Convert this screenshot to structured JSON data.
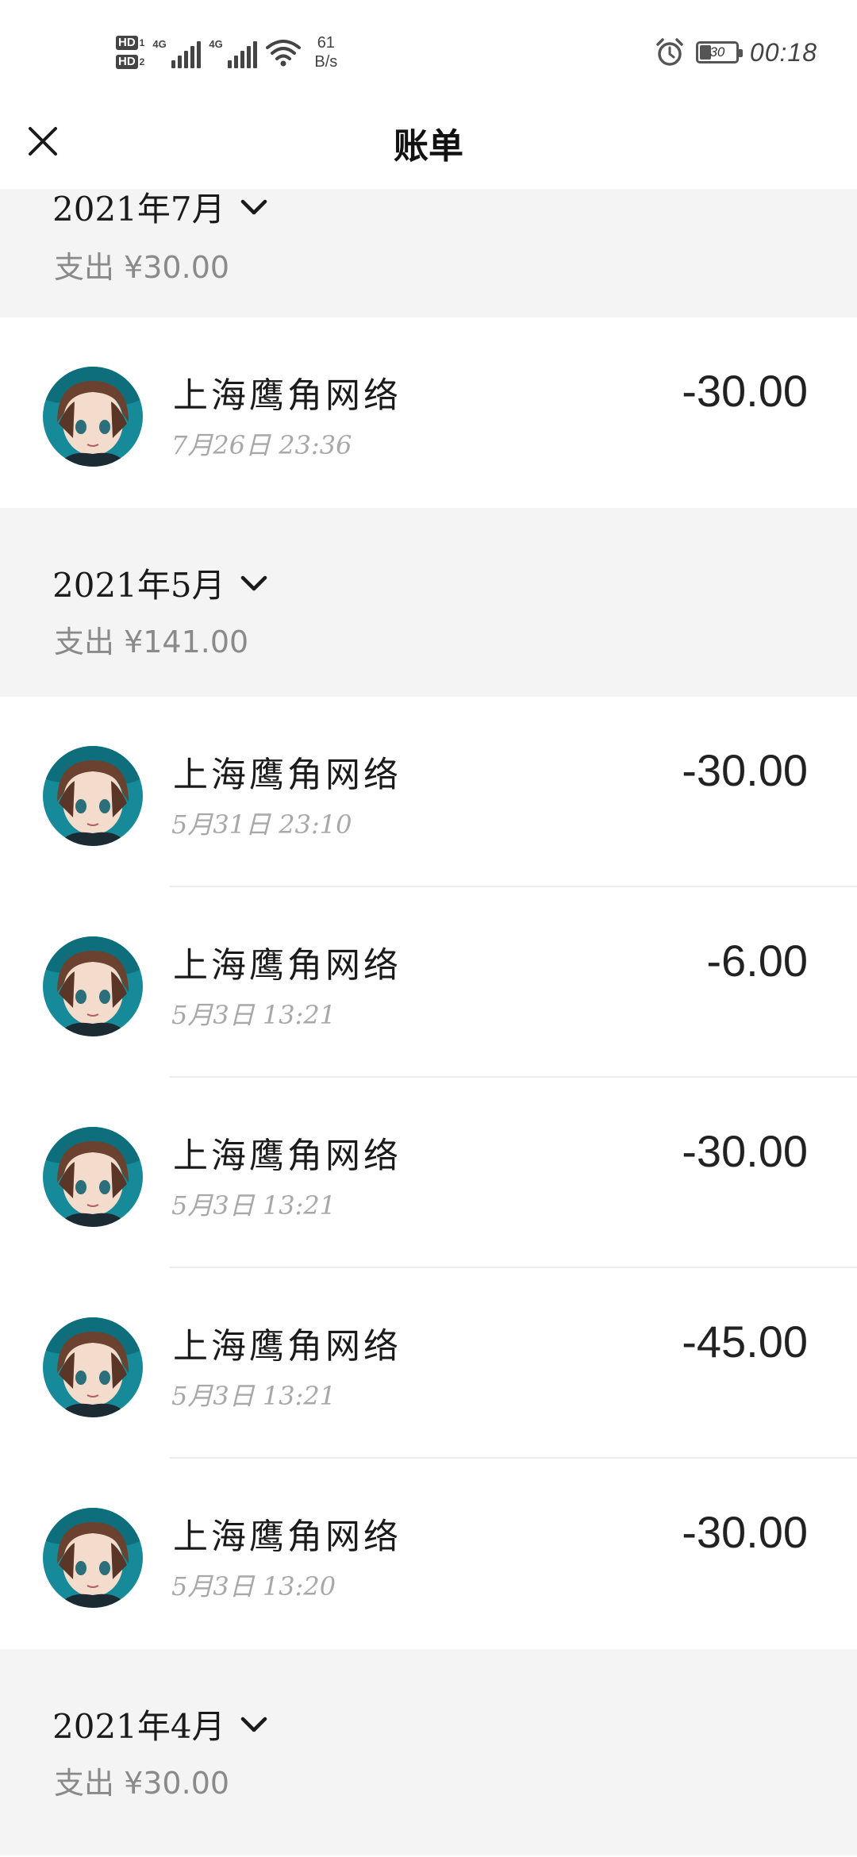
{
  "status_bar": {
    "hd1": "HD",
    "hd1_num": "1",
    "hd2": "HD",
    "hd2_num": "2",
    "net1": "4G",
    "net2": "4G",
    "speed_value": "61",
    "speed_unit": "B/s",
    "battery": "30",
    "time": "00:18"
  },
  "header": {
    "title": "账单",
    "close_icon": "close-icon"
  },
  "months": [
    {
      "title": "2021年7月",
      "expense": "支出 ¥30.00",
      "transactions": [
        {
          "merchant": "上海鹰角网络",
          "time": "7月26日 23:36",
          "amount": "-30.00"
        }
      ]
    },
    {
      "title": "2021年5月",
      "expense": "支出 ¥141.00",
      "transactions": [
        {
          "merchant": "上海鹰角网络",
          "time": "5月31日 23:10",
          "amount": "-30.00"
        },
        {
          "merchant": "上海鹰角网络",
          "time": "5月3日 13:21",
          "amount": "-6.00"
        },
        {
          "merchant": "上海鹰角网络",
          "time": "5月3日 13:21",
          "amount": "-30.00"
        },
        {
          "merchant": "上海鹰角网络",
          "time": "5月3日 13:21",
          "amount": "-45.00"
        },
        {
          "merchant": "上海鹰角网络",
          "time": "5月3日 13:20",
          "amount": "-30.00"
        }
      ]
    },
    {
      "title": "2021年4月",
      "expense": "支出 ¥30.00",
      "transactions": []
    }
  ],
  "colors": {
    "month_bg": "#f4f4f4",
    "row_bg": "#ffffff",
    "muted_text": "#8a8a8a",
    "avatar_teal": "#1a8f9e"
  }
}
